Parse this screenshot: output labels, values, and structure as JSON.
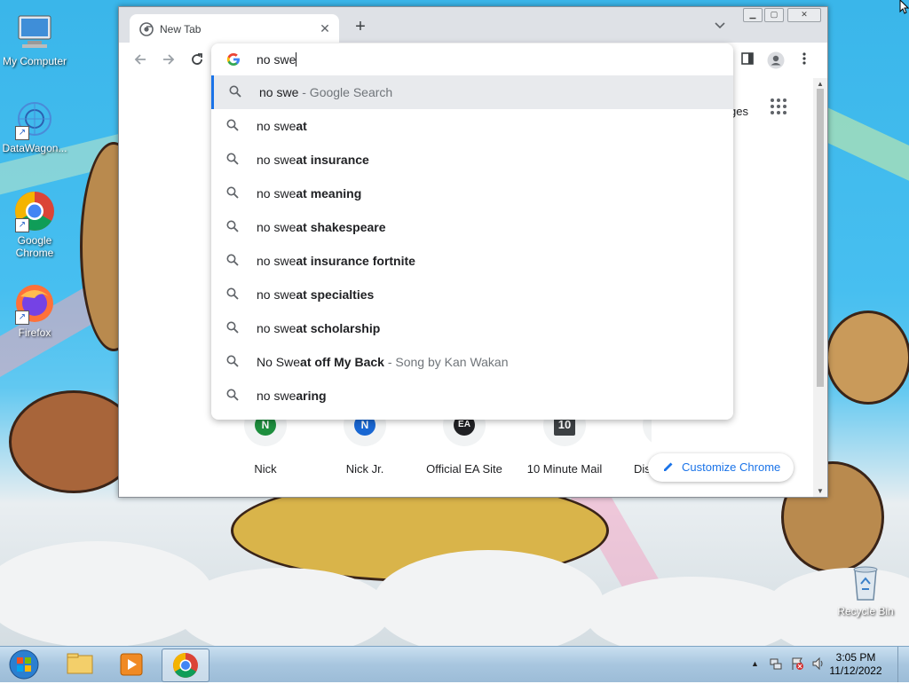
{
  "desktop": {
    "icons": [
      {
        "label": "My Computer",
        "icon": "computer-icon"
      },
      {
        "label": "DataWagon...",
        "icon": "datawagon-icon"
      },
      {
        "label": "Google Chrome",
        "icon": "chrome-icon"
      },
      {
        "label": "Firefox",
        "icon": "firefox-icon"
      },
      {
        "label": "Recycle Bin",
        "icon": "recycle-bin-icon"
      }
    ]
  },
  "browser": {
    "tab_title": "New Tab",
    "tab_close": "✕",
    "new_tab": "+",
    "omnibox_text": "no swe",
    "partial_right_text": "ges",
    "suggestions": [
      {
        "typed": "no swe",
        "completion": "",
        "secondary": " - Google Search"
      },
      {
        "typed": "no swe",
        "completion": "at",
        "secondary": ""
      },
      {
        "typed": "no swe",
        "completion": "at insurance",
        "secondary": ""
      },
      {
        "typed": "no swe",
        "completion": "at meaning",
        "secondary": ""
      },
      {
        "typed": "no swe",
        "completion": "at shakespeare",
        "secondary": ""
      },
      {
        "typed": "no swe",
        "completion": "at insurance fortnite",
        "secondary": ""
      },
      {
        "typed": "no swe",
        "completion": "at specialties",
        "secondary": ""
      },
      {
        "typed": "no swe",
        "completion": "at scholarship",
        "secondary": ""
      },
      {
        "typed": "No Swe",
        "completion": "at off My Back",
        "secondary": " - Song by Kan Wakan"
      },
      {
        "typed": "no swe",
        "completion": "aring",
        "secondary": ""
      }
    ],
    "shortcuts": [
      {
        "label": "Nick",
        "glyph": "N",
        "color": "#1e8e3e"
      },
      {
        "label": "Nick Jr.",
        "glyph": "N",
        "color": "#1967d2"
      },
      {
        "label": "Official EA Site",
        "glyph": "EA",
        "color": "#202124"
      },
      {
        "label": "10 Minute Mail",
        "glyph": "10",
        "color": "#3c4043"
      },
      {
        "label": "Dis",
        "glyph": "D",
        "color": "#202124"
      }
    ],
    "customize_label": "Customize Chrome"
  },
  "taskbar": {
    "time": "3:05 PM",
    "date": "11/12/2022"
  }
}
